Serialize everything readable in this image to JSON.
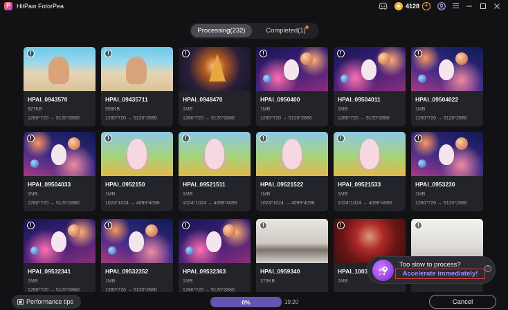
{
  "app": {
    "title": "HitPaw FotorPea",
    "logo_letter": "P",
    "credits": "4128"
  },
  "titlebar_icons": [
    "discord-icon",
    "coin-icon",
    "add-credits-icon",
    "user-icon",
    "menu-icon",
    "minimize-icon",
    "maximize-icon",
    "close-icon"
  ],
  "tabs": [
    {
      "label": "Processing(232)",
      "active": true
    },
    {
      "label": "Completed(1)",
      "active": false,
      "has_dot": true
    }
  ],
  "cards": [
    {
      "name": "HPAI_0943570",
      "size": "927KB",
      "res": "1280*720 → 5120*2880",
      "thumb": "beach"
    },
    {
      "name": "HPAI_09435711",
      "size": "958KB",
      "res": "1280*720 → 5120*2880",
      "thumb": "beach"
    },
    {
      "name": "HPAI_0948470",
      "size": "1MB",
      "res": "1280*720 → 5120*2880",
      "thumb": "christmas"
    },
    {
      "name": "HPAI_0950400",
      "size": "1MB",
      "res": "1280*720 → 5120*2880",
      "thumb": "space"
    },
    {
      "name": "HPAI_09504011",
      "size": "1MB",
      "res": "1280*720 → 5120*2880",
      "thumb": "space"
    },
    {
      "name": "HPAI_09504022",
      "size": "1MB",
      "res": "1280*720 → 5120*2880",
      "thumb": "space2"
    },
    {
      "name": "HPAI_09504033",
      "size": "1MB",
      "res": "1280*720 → 5120*2880",
      "thumb": "space2"
    },
    {
      "name": "HPAI_0952150",
      "size": "1MB",
      "res": "1024*1024 → 4096*4096",
      "thumb": "playground"
    },
    {
      "name": "HPAI_09521511",
      "size": "1MB",
      "res": "1024*1024 → 4096*4096",
      "thumb": "playground"
    },
    {
      "name": "HPAI_09521522",
      "size": "1MB",
      "res": "1024*1024 → 4096*4096",
      "thumb": "playground"
    },
    {
      "name": "HPAI_09521533",
      "size": "1MB",
      "res": "1024*1024 → 4096*4096",
      "thumb": "playground"
    },
    {
      "name": "HPAI_0953230",
      "size": "1MB",
      "res": "1280*720 → 5120*2880",
      "thumb": "space2"
    },
    {
      "name": "HPAI_09532341",
      "size": "1MB",
      "res": "1280*720 → 5120*2880",
      "thumb": "space"
    },
    {
      "name": "HPAI_09532352",
      "size": "1MB",
      "res": "1280*720 → 5120*2880",
      "thumb": "space2"
    },
    {
      "name": "HPAI_09532363",
      "size": "1MB",
      "res": "1280*720 → 5120*2880",
      "thumb": "space"
    },
    {
      "name": "HPAI_0959340",
      "size": "376KB",
      "res": "",
      "thumb": "room"
    },
    {
      "name": "HPAI_100359",
      "size": "1MB",
      "res": "",
      "thumb": "bride"
    },
    {
      "name": "",
      "size": "1MB",
      "res": "",
      "thumb": "sketch"
    }
  ],
  "popup": {
    "question": "Too slow to process?",
    "cta": "Accelerate immediately!",
    "highlight_color": "#e2352f"
  },
  "bottom": {
    "perf_tips": "Performance tips",
    "progress_label": "0%",
    "progress_value": 0,
    "time_remaining": "19:20",
    "cancel": "Cancel"
  },
  "colors": {
    "accent": "#6655b0",
    "background": "#121214",
    "card": "#23232a"
  }
}
